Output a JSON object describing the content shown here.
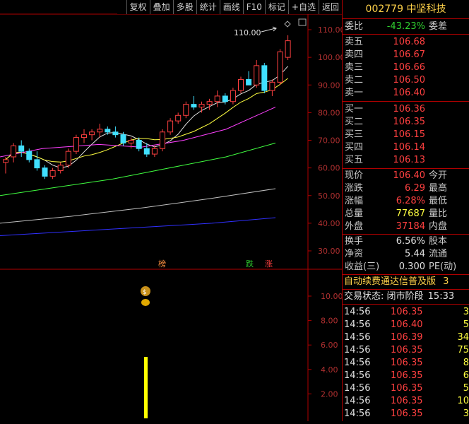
{
  "toolbar": {
    "buttons": [
      "复权",
      "叠加",
      "多股",
      "统计",
      "画线",
      "F10",
      "标记",
      "+自选",
      "返回"
    ]
  },
  "stock": {
    "code": "002779",
    "name": "中坚科技"
  },
  "chart_labels": {
    "peak_label": "110.00",
    "marker_bang": "榜",
    "marker_die": "跌",
    "marker_zhang": "涨"
  },
  "price_axis": [
    "110.00",
    "100.00",
    "90.00",
    "80.00",
    "70.00",
    "60.00",
    "50.00",
    "40.00",
    "30.00"
  ],
  "vol_axis": [
    "10.00",
    "8.00",
    "6.00",
    "4.00",
    "2.00"
  ],
  "quote": {
    "weibi_label": "委比",
    "weibi_value": "-43.23%",
    "weicha_label": "委差",
    "sell": [
      {
        "label": "卖五",
        "price": "106.68"
      },
      {
        "label": "卖四",
        "price": "106.67"
      },
      {
        "label": "卖三",
        "price": "106.66"
      },
      {
        "label": "卖二",
        "price": "106.50"
      },
      {
        "label": "卖一",
        "price": "106.40"
      }
    ],
    "buy": [
      {
        "label": "买一",
        "price": "106.36"
      },
      {
        "label": "买二",
        "price": "106.35"
      },
      {
        "label": "买三",
        "price": "106.15"
      },
      {
        "label": "买四",
        "price": "106.14"
      },
      {
        "label": "买五",
        "price": "106.13"
      }
    ],
    "stats1": [
      {
        "label": "现价",
        "value": "106.40",
        "color": "red",
        "label2": "今开"
      },
      {
        "label": "涨跌",
        "value": "6.29",
        "color": "red",
        "label2": "最高"
      },
      {
        "label": "涨幅",
        "value": "6.28%",
        "color": "red",
        "label2": "最低"
      },
      {
        "label": "总量",
        "value": "77687",
        "color": "yellow",
        "label2": "量比"
      },
      {
        "label": "外盘",
        "value": "37184",
        "color": "red",
        "label2": "内盘"
      }
    ],
    "stats2": [
      {
        "label": "换手",
        "value": "6.56%",
        "color": "white",
        "label2": "股本"
      },
      {
        "label": "净资",
        "value": "5.44",
        "color": "white",
        "label2": "流通"
      },
      {
        "label": "收益(三)",
        "value": "0.300",
        "color": "white",
        "label2": "PE(动)"
      }
    ],
    "ad_text": "自动续费通达信普及版",
    "ad_suffix": "3",
    "status_text": "交易状态: 闭市阶段",
    "status_time": "15:33",
    "ticks": [
      {
        "time": "14:56",
        "price": "106.35",
        "vol": "3"
      },
      {
        "time": "14:56",
        "price": "106.40",
        "vol": "5"
      },
      {
        "time": "14:56",
        "price": "106.39",
        "vol": "34"
      },
      {
        "time": "14:56",
        "price": "106.35",
        "vol": "75"
      },
      {
        "time": "14:56",
        "price": "106.35",
        "vol": "8"
      },
      {
        "time": "14:56",
        "price": "106.35",
        "vol": "6"
      },
      {
        "time": "14:56",
        "price": "106.35",
        "vol": "5"
      },
      {
        "time": "14:56",
        "price": "106.35",
        "vol": "10"
      },
      {
        "time": "14:56",
        "price": "106.35",
        "vol": "3"
      }
    ]
  },
  "colors": {
    "up": "#ff4040",
    "down": "#40e0ff",
    "ma5": "#e0e0e0",
    "ma10": "#ffff40",
    "ma20": "#ff40ff",
    "ma60": "#40ff40",
    "ma120": "#c0c0c0",
    "ma250": "#3030ff",
    "vol_bar": "#ffff00"
  }
}
